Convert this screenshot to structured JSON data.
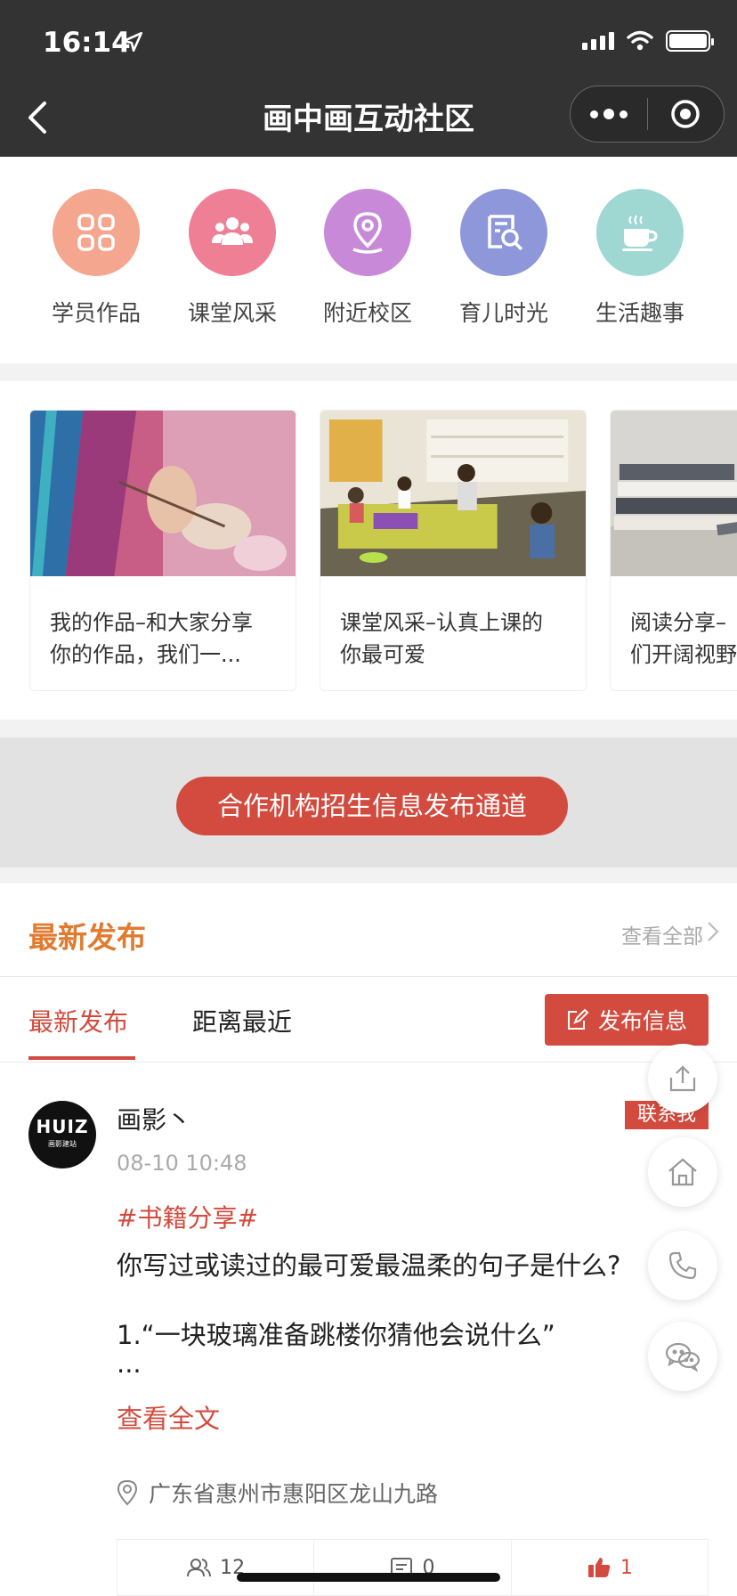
{
  "status_bar": {
    "time": "16:14"
  },
  "nav": {
    "title": "画中画互动社区"
  },
  "categories": [
    {
      "label": "学员作品",
      "color": "#f4a68f",
      "icon": "grid-icon"
    },
    {
      "label": "课堂风采",
      "color": "#ee7f94",
      "icon": "group-icon"
    },
    {
      "label": "附近校区",
      "color": "#c88ad8",
      "icon": "location-pin-icon"
    },
    {
      "label": "育儿时光",
      "color": "#8e97d9",
      "icon": "book-search-icon"
    },
    {
      "label": "生活趣事",
      "color": "#9fd8d3",
      "icon": "coffee-cup-icon"
    }
  ],
  "articles": [
    {
      "line1": "我的作品–和大家分享",
      "line2": "你的作品，我们一..."
    },
    {
      "line1": "课堂风采–认真上课的",
      "line2": "你最可爱"
    },
    {
      "line1": "阅读分享–",
      "line2": "们开阔视野"
    }
  ],
  "banner": {
    "label": "合作机构招生信息发布通道"
  },
  "latest": {
    "title": "最新发布",
    "view_all": "查看全部",
    "tabs": [
      "最新发布",
      "距离最近"
    ],
    "publish_label": "发布信息"
  },
  "post": {
    "avatar_text": "HUIZ",
    "avatar_sub": "画影建站",
    "author": "画影丶",
    "contact": "联系我",
    "time": "08-10 10:48",
    "tag": "#书籍分享#",
    "line1": "你写过或读过的最可爱最温柔的句子是什么?",
    "line2": "1.“一块玻璃准备跳楼你猜他会说什么”",
    "line3": "...",
    "read_more": "查看全文",
    "location": "广东省惠州市惠阳区龙山九路",
    "views": "12",
    "comments": "0",
    "likes": "1"
  },
  "colors": {
    "accent": "#d24b3e",
    "section_title": "#e07b30",
    "nav_bg": "#333333"
  }
}
